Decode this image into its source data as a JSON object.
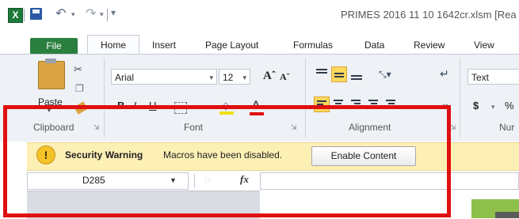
{
  "app": {
    "window_title": "PRIMES 2016 11 10 1642cr.xlsm  [Rea",
    "logo_letter": "X",
    "icons": {
      "logo": "excel-logo-icon",
      "save": "save-icon",
      "undo": "undo-icon",
      "redo": "redo-icon",
      "customize": "qat-customize-icon"
    }
  },
  "tabs": {
    "file": "File",
    "home": "Home",
    "insert": "Insert",
    "page_layout": "Page Layout",
    "formulas": "Formulas",
    "data": "Data",
    "review": "Review",
    "view": "View",
    "active": "Home"
  },
  "ribbon": {
    "clipboard": {
      "label": "Clipboard",
      "paste_label": "Paste",
      "icons": [
        "paste-icon",
        "cut-icon",
        "copy-icon",
        "format-painter-icon"
      ]
    },
    "font": {
      "label": "Font",
      "font_name": "Arial",
      "font_size": "12",
      "grow_glyph": "Aˆ",
      "shrink_glyph": "Aˇ",
      "bold": "B",
      "italic": "I",
      "underline": "U",
      "font_color_glyph": "A",
      "fill_color": "#f0e010",
      "font_color": "#e01010"
    },
    "alignment": {
      "label": "Alignment",
      "selected": [
        "middle-align",
        "align-left"
      ],
      "highlight_color": "#f9d85b"
    },
    "number": {
      "label": "Nur",
      "format": "Text",
      "currency": "$",
      "percent": "%"
    }
  },
  "security_bar": {
    "title": "Security Warning",
    "message": "Macros have been disabled.",
    "button": "Enable Content",
    "icon_glyph": "!",
    "background": "#fdf0b5"
  },
  "formula_bar": {
    "name_box": "D285",
    "fx": "fx",
    "formula": ""
  },
  "annotation": {
    "border_color": "#e01010"
  }
}
